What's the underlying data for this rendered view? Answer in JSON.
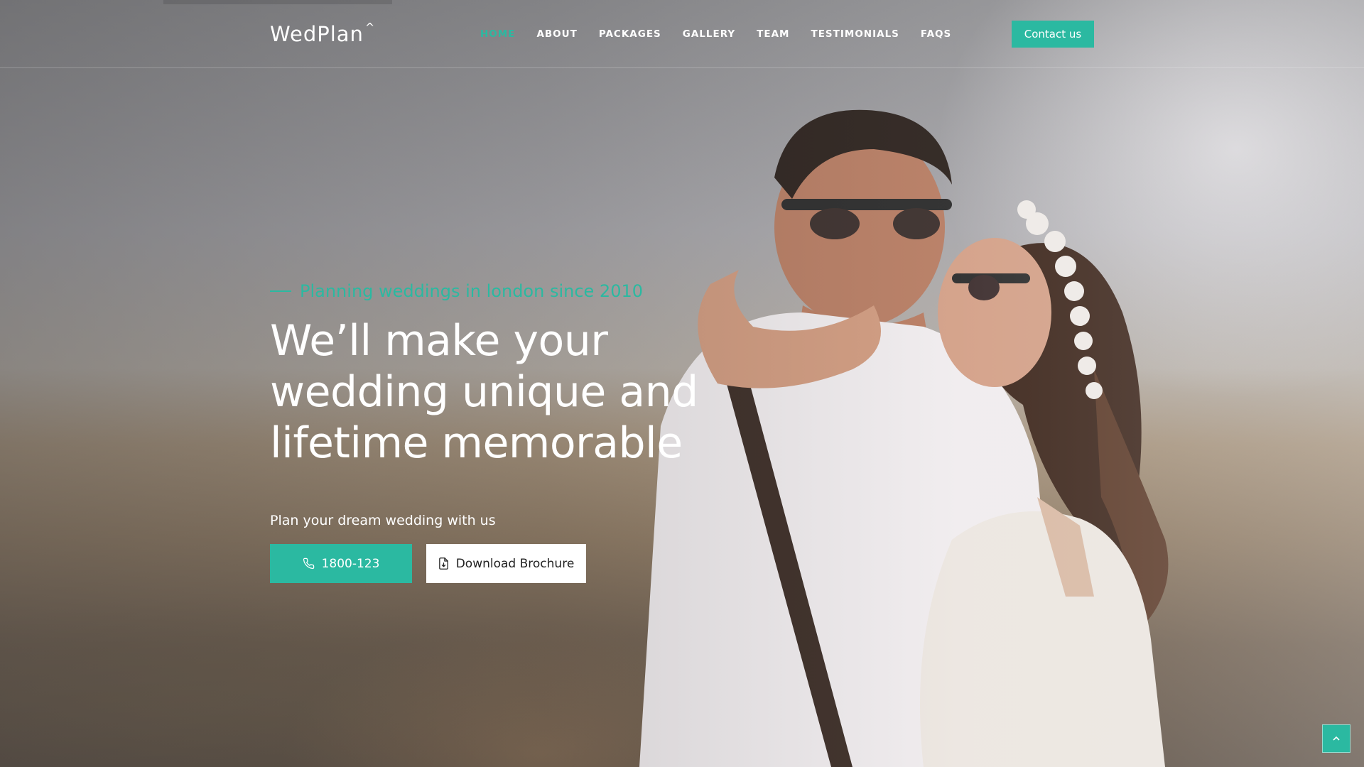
{
  "header": {
    "logo": "WedPlan",
    "logo_mark": "^",
    "nav": [
      {
        "label": "HOME",
        "active": true
      },
      {
        "label": "ABOUT"
      },
      {
        "label": "PACKAGES"
      },
      {
        "label": "GALLERY"
      },
      {
        "label": "TEAM"
      },
      {
        "label": "TESTIMONIALS"
      },
      {
        "label": "FAQS"
      }
    ],
    "contact_label": "Contact us"
  },
  "hero": {
    "tagline": "Planning weddings in london since 2010",
    "headline_lines": [
      "We’ll make your",
      "wedding unique and",
      "lifetime memorable"
    ],
    "subtext": "Plan your dream wedding with us",
    "phone_label": "1800-123",
    "brochure_label": "Download Brochure",
    "icons": {
      "phone": "phone-icon",
      "brochure": "file-download-icon",
      "scroll_top": "chevron-up-icon"
    }
  },
  "colors": {
    "accent": "#2bb9a1",
    "text_light": "#ffffff",
    "button_light": "#ffffff"
  }
}
